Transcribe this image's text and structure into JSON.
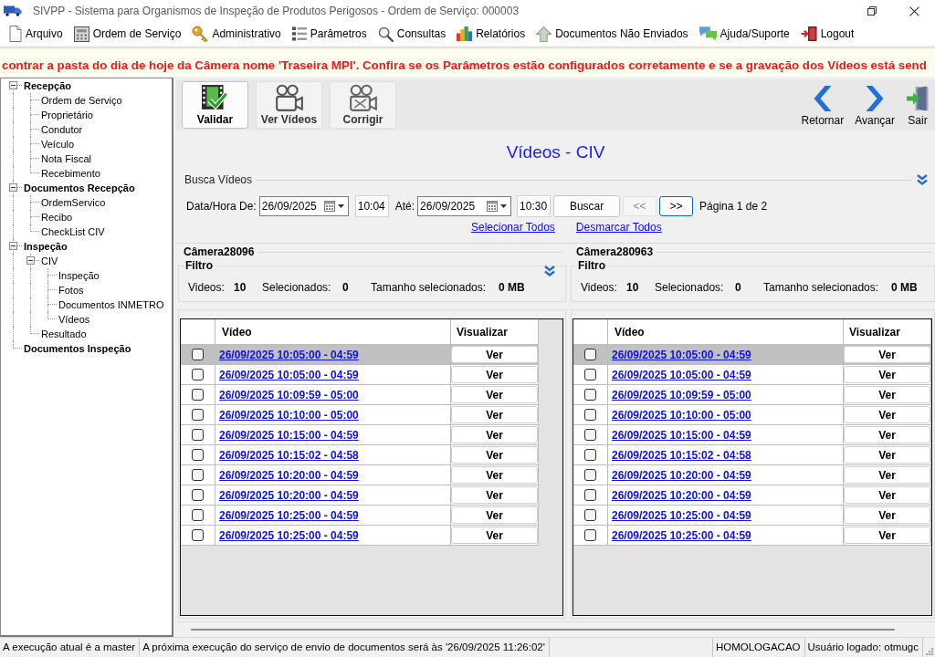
{
  "window": {
    "title": "SIVPP - Sistema para Organismos de Inspeção de Produtos Perigosos - Ordem de Serviço: 000003"
  },
  "menu": [
    {
      "label": "Arquivo"
    },
    {
      "label": "Ordem de Serviço"
    },
    {
      "label": "Administrativo"
    },
    {
      "label": "Parâmetros"
    },
    {
      "label": "Consultas"
    },
    {
      "label": "Relatórios"
    },
    {
      "label": "Documentos Não Enviados"
    },
    {
      "label": "Ajuda/Suporte"
    },
    {
      "label": "Logout"
    }
  ],
  "banner": {
    "text": "contrar a pasta do dia de hoje da Câmera nome 'Traseira MPI'. Confira se os Parâmetros estão configurados corretamente e se a gravação dos Vídeos está send"
  },
  "tree": [
    {
      "label": "Recepção",
      "expanded": true,
      "children": [
        {
          "label": "Ordem de Serviço"
        },
        {
          "label": "Proprietário"
        },
        {
          "label": "Condutor"
        },
        {
          "label": "Veículo"
        },
        {
          "label": "Nota Fiscal"
        },
        {
          "label": "Recebimento"
        }
      ]
    },
    {
      "label": "Documentos Recepção",
      "expanded": true,
      "children": [
        {
          "label": "OrdemServico"
        },
        {
          "label": "Recibo"
        },
        {
          "label": "CheckList CIV"
        }
      ]
    },
    {
      "label": "Inspeção",
      "expanded": true,
      "children": [
        {
          "label": "CIV",
          "expanded": true,
          "children": [
            {
              "label": "Inspeção"
            },
            {
              "label": "Fotos"
            },
            {
              "label": "Documentos INMETRO"
            },
            {
              "label": "Vídeos"
            }
          ]
        },
        {
          "label": "Resultado"
        }
      ]
    },
    {
      "label": "Documentos Inspeção"
    }
  ],
  "toolbar": {
    "actions": [
      {
        "label": "Validar",
        "selected": true
      },
      {
        "label": "Ver Vídeos",
        "selected": false
      },
      {
        "label": "Corrigir",
        "selected": false
      }
    ],
    "navigation": [
      {
        "label": "Retornar"
      },
      {
        "label": "Avançar"
      },
      {
        "label": "Sair"
      }
    ]
  },
  "page_title": "Vídeos - CIV",
  "search": {
    "title": "Busca Vídeos",
    "from": {
      "label": "Data/Hora De:",
      "date": "26/09/2025",
      "time": "10:04"
    },
    "to": {
      "label": "Até:",
      "date": "26/09/2025",
      "time": "10:30"
    },
    "search_button": "Buscar",
    "pager": [
      {
        "label": "<<",
        "disabled": true,
        "focused": false
      },
      {
        "label": ">>",
        "disabled": false,
        "focused": true
      }
    ],
    "page_info": "Página 1 de 2",
    "links": [
      "Selecionar Todos",
      "Desmarcar Todos"
    ]
  },
  "cameras": [
    {
      "name": "Câmera28096",
      "filter_title": "Filtro",
      "collapsible": true,
      "stats": [
        {
          "label": "Videos:",
          "value": "10"
        },
        {
          "label": "Selecionados:",
          "value": "0"
        },
        {
          "label": "Tamanho selecionados:",
          "value": "0 MB"
        }
      ],
      "columns": [
        "Vídeo",
        "Visualizar"
      ],
      "rows": [
        {
          "video": "26/09/2025 10:05:00 - 04:59",
          "action": "Ver",
          "checked": false,
          "selected": true
        },
        {
          "video": "26/09/2025 10:05:00 - 04:59",
          "action": "Ver",
          "checked": false,
          "selected": false
        },
        {
          "video": "26/09/2025 10:09:59 - 05:00",
          "action": "Ver",
          "checked": false,
          "selected": false
        },
        {
          "video": "26/09/2025 10:10:00 - 05:00",
          "action": "Ver",
          "checked": false,
          "selected": false
        },
        {
          "video": "26/09/2025 10:15:00 - 04:59",
          "action": "Ver",
          "checked": false,
          "selected": false
        },
        {
          "video": "26/09/2025 10:15:02 - 04:58",
          "action": "Ver",
          "checked": false,
          "selected": false
        },
        {
          "video": "26/09/2025 10:20:00 - 04:59",
          "action": "Ver",
          "checked": false,
          "selected": false
        },
        {
          "video": "26/09/2025 10:20:00 - 04:59",
          "action": "Ver",
          "checked": false,
          "selected": false
        },
        {
          "video": "26/09/2025 10:25:00 - 04:59",
          "action": "Ver",
          "checked": false,
          "selected": false
        },
        {
          "video": "26/09/2025 10:25:00 - 04:59",
          "action": "Ver",
          "checked": false,
          "selected": false
        }
      ]
    },
    {
      "name": "Câmera280963",
      "filter_title": "Filtro",
      "collapsible": false,
      "stats": [
        {
          "label": "Videos:",
          "value": "10"
        },
        {
          "label": "Selecionados:",
          "value": "0"
        },
        {
          "label": "Tamanho selecionados:",
          "value": "0 MB"
        }
      ],
      "columns": [
        "Vídeo",
        "Visualizar"
      ],
      "rows": [
        {
          "video": "26/09/2025 10:05:00 - 04:59",
          "action": "Ver",
          "checked": false,
          "selected": true
        },
        {
          "video": "26/09/2025 10:05:00 - 04:59",
          "action": "Ver",
          "checked": false,
          "selected": false
        },
        {
          "video": "26/09/2025 10:09:59 - 05:00",
          "action": "Ver",
          "checked": false,
          "selected": false
        },
        {
          "video": "26/09/2025 10:10:00 - 05:00",
          "action": "Ver",
          "checked": false,
          "selected": false
        },
        {
          "video": "26/09/2025 10:15:00 - 04:59",
          "action": "Ver",
          "checked": false,
          "selected": false
        },
        {
          "video": "26/09/2025 10:15:02 - 04:58",
          "action": "Ver",
          "checked": false,
          "selected": false
        },
        {
          "video": "26/09/2025 10:20:00 - 04:59",
          "action": "Ver",
          "checked": false,
          "selected": false
        },
        {
          "video": "26/09/2025 10:20:00 - 04:59",
          "action": "Ver",
          "checked": false,
          "selected": false
        },
        {
          "video": "26/09/2025 10:25:00 - 04:59",
          "action": "Ver",
          "checked": false,
          "selected": false
        },
        {
          "video": "26/09/2025 10:25:00 - 04:59",
          "action": "Ver",
          "checked": false,
          "selected": false
        }
      ]
    }
  ],
  "status_bar": {
    "left": [
      "A execução atual é a master",
      "A próxima execução do serviço de envio de documentos será às '26/09/2025 11:26:02'"
    ],
    "right": [
      "HOMOLOGACAO",
      "Usuário logado: otmugc"
    ]
  }
}
